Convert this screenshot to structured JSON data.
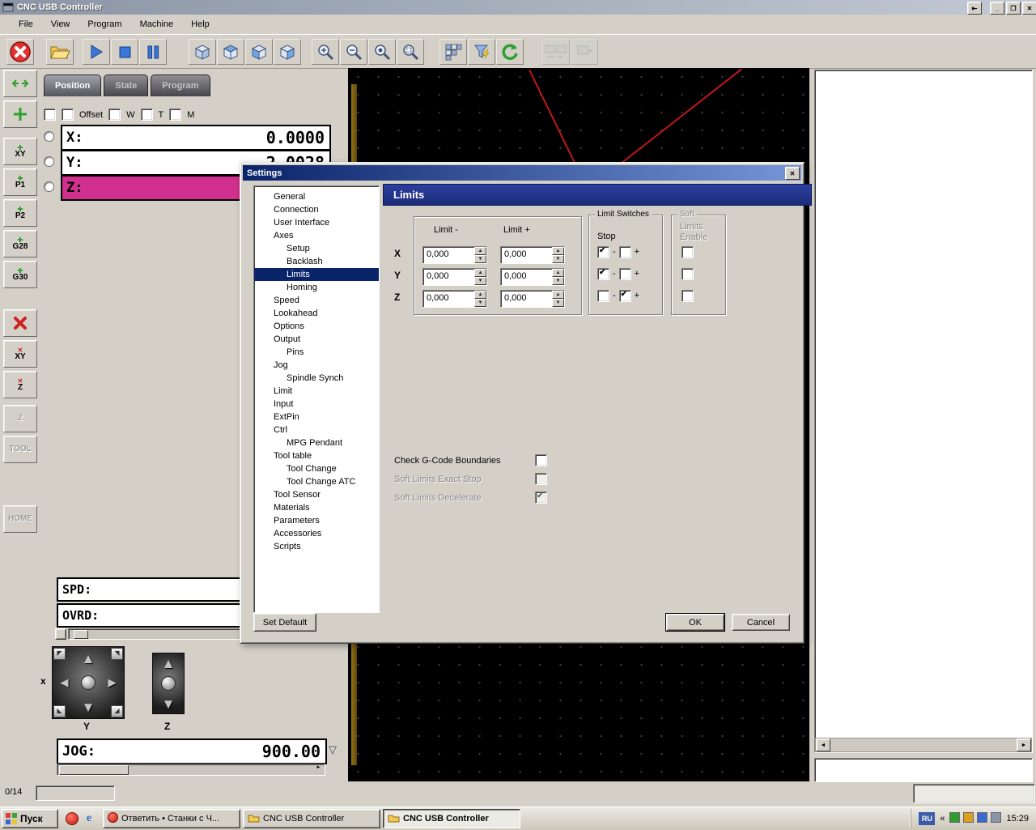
{
  "window": {
    "title": "CNC USB Controller",
    "controls": {
      "dock": "⇤",
      "minimize": "_",
      "restore": "❐",
      "close": "✕"
    }
  },
  "icons": {
    "dropdown": "▽",
    "arrow_left": "◄",
    "arrow_right": "►",
    "arrow_up": "▲",
    "arrow_down": "▼"
  },
  "menu": {
    "items": [
      "File",
      "View",
      "Program",
      "Machine",
      "Help"
    ]
  },
  "toolbar": {
    "groups": [
      {
        "buttons": [
          {
            "icon": "emergency-stop"
          }
        ]
      },
      {
        "buttons": [
          {
            "icon": "open-file"
          }
        ]
      },
      {
        "buttons": [
          {
            "icon": "play"
          },
          {
            "icon": "stop"
          },
          {
            "icon": "pause"
          }
        ]
      },
      {
        "buttons": [
          {
            "icon": "view-perspective"
          },
          {
            "icon": "view-top"
          },
          {
            "icon": "view-front"
          },
          {
            "icon": "view-side"
          }
        ]
      },
      {
        "buttons": [
          {
            "icon": "zoom-in"
          },
          {
            "icon": "zoom-out"
          },
          {
            "icon": "zoom-extents"
          },
          {
            "icon": "zoom-window"
          }
        ]
      },
      {
        "buttons": [
          {
            "icon": "simulate"
          },
          {
            "icon": "filter"
          },
          {
            "icon": "regenerate"
          }
        ]
      },
      {
        "buttons": [
          {
            "icon": "sim-windows",
            "disabled": true
          },
          {
            "icon": "sim-run",
            "disabled": true
          }
        ]
      }
    ]
  },
  "sidebar": {
    "buttons": [
      {
        "label": "",
        "icon": "goto-zero"
      },
      {
        "label": "",
        "icon": "set-zero"
      },
      {
        "label": "XY",
        "accent": "green"
      },
      {
        "label": "P1",
        "accent": "green"
      },
      {
        "label": "P2",
        "accent": "green"
      },
      {
        "label": "G28",
        "accent": "green"
      },
      {
        "label": "G30",
        "accent": "green"
      },
      {
        "label": "",
        "icon": "clear-offset"
      },
      {
        "label": "XY",
        "accent": "red"
      },
      {
        "label": "Z",
        "accent": "red"
      },
      {
        "label": "Z",
        "disabled": true
      },
      {
        "label": "TOOL",
        "disabled": true
      },
      {
        "label": "HOME",
        "disabled": true
      }
    ]
  },
  "position_panel": {
    "tabs": [
      {
        "label": "Position",
        "active": true
      },
      {
        "label": "State",
        "active": false
      },
      {
        "label": "Program",
        "active": false
      }
    ],
    "option_row": [
      {
        "type": "cb"
      },
      {
        "type": "cb"
      },
      {
        "type": "label",
        "text": "Offset"
      },
      {
        "type": "cb"
      },
      {
        "type": "label",
        "text": "W"
      },
      {
        "type": "cb"
      },
      {
        "type": "label",
        "text": "T"
      },
      {
        "type": "cb"
      },
      {
        "type": "label",
        "text": "M"
      }
    ],
    "axes": [
      {
        "label": "X:",
        "value": "0.0000",
        "highlight": false
      },
      {
        "label": "Y:",
        "value": "2.0028",
        "highlight": false
      },
      {
        "label": "Z:",
        "value": "",
        "highlight": true
      }
    ],
    "spd_label": "SPD:",
    "ovrd_label": "OVRD:",
    "jog": {
      "label": "JOG:",
      "value": "900.00"
    },
    "jog_pad": {
      "x_label": "x",
      "y_label": "Y",
      "z_label": "Z"
    },
    "progress_label": "0/14"
  },
  "settings": {
    "title": "Settings",
    "tree": [
      {
        "label": "General",
        "indent": 0
      },
      {
        "label": "Connection",
        "indent": 0
      },
      {
        "label": "User Interface",
        "indent": 0
      },
      {
        "label": "Axes",
        "indent": 0
      },
      {
        "label": "Setup",
        "indent": 1
      },
      {
        "label": "Backlash",
        "indent": 1
      },
      {
        "label": "Limits",
        "indent": 1,
        "selected": true
      },
      {
        "label": "Homing",
        "indent": 1
      },
      {
        "label": "Speed",
        "indent": 0
      },
      {
        "label": "Lookahead",
        "indent": 0
      },
      {
        "label": "Options",
        "indent": 0
      },
      {
        "label": "Output",
        "indent": 0
      },
      {
        "label": "Pins",
        "indent": 1
      },
      {
        "label": "Jog",
        "indent": 0
      },
      {
        "label": "Spindle Synch",
        "indent": 1
      },
      {
        "label": "Limit",
        "indent": 0
      },
      {
        "label": "Input",
        "indent": 0
      },
      {
        "label": "ExtPin",
        "indent": 0
      },
      {
        "label": "Ctrl",
        "indent": 0
      },
      {
        "label": "MPG Pendant",
        "indent": 1
      },
      {
        "label": "Tool table",
        "indent": 0
      },
      {
        "label": "Tool Change",
        "indent": 1
      },
      {
        "label": "Tool Change ATC",
        "indent": 1
      },
      {
        "label": "Tool Sensor",
        "indent": 0
      },
      {
        "label": "Materials",
        "indent": 0
      },
      {
        "label": "Parameters",
        "indent": 0
      },
      {
        "label": "Accessories",
        "indent": 0
      },
      {
        "label": "Scripts",
        "indent": 0
      }
    ],
    "panel": {
      "header": "Limits",
      "columns": {
        "minus": "Limit -",
        "plus": "Limit +"
      },
      "rows": [
        {
          "axis": "X",
          "minus": "0,000",
          "plus": "0,000"
        },
        {
          "axis": "Y",
          "minus": "0,000",
          "plus": "0,000"
        },
        {
          "axis": "Z",
          "minus": "0,000",
          "plus": "0,000"
        }
      ],
      "limit_switches": {
        "title": "Limit Switches",
        "subtitle": "Stop",
        "minus_label": "-",
        "plus_label": "+",
        "rows": [
          {
            "minus_checked": true,
            "plus_checked": false
          },
          {
            "minus_checked": true,
            "plus_checked": false
          },
          {
            "minus_checked": false,
            "plus_checked": true
          }
        ]
      },
      "soft_limits": {
        "caption": "Soft",
        "line2": "Limits",
        "line3": "Enable",
        "checks": [
          false,
          false,
          false
        ]
      },
      "checkboxes": [
        {
          "label": "Check G-Code Boundaries",
          "checked": false,
          "disabled": false
        },
        {
          "label": "Soft Limits Exact Stop",
          "checked": false,
          "disabled": true
        },
        {
          "label": "Soft Limits Decelerate",
          "checked": true,
          "disabled": true
        }
      ]
    },
    "buttons": {
      "set_default": "Set Default",
      "ok": "OK",
      "cancel": "Cancel"
    }
  },
  "taskbar": {
    "start_label": "Пуск",
    "quick_launch": [
      "browser-red",
      "browser-e"
    ],
    "tasks": [
      {
        "label": "Ответить • Станки с Ч...",
        "icon": "mail",
        "active": false
      },
      {
        "label": "CNC USB Controller",
        "icon": "folder",
        "active": false
      },
      {
        "label": "CNC USB Controller",
        "icon": "folder",
        "active": true
      }
    ],
    "tray": {
      "lang": "RU",
      "expand": "«",
      "icons": [
        "antivirus",
        "update",
        "network",
        "display"
      ],
      "time": "15:29"
    }
  }
}
